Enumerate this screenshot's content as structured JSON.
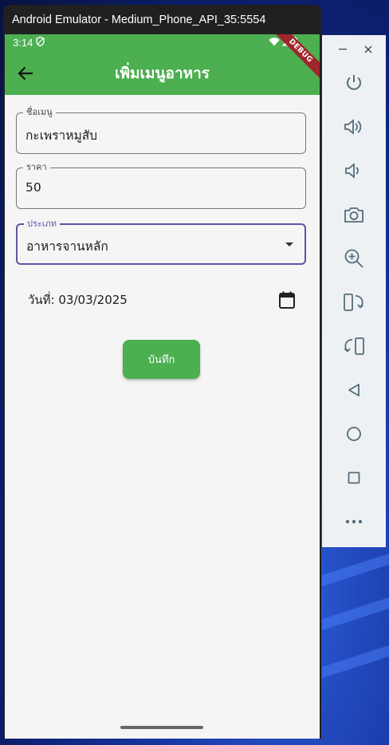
{
  "window": {
    "title": "Android Emulator - Medium_Phone_API_35:5554"
  },
  "status_bar": {
    "time": "3:14",
    "debug_banner": "DEBUG"
  },
  "app_bar": {
    "title": "เพิ่มเมนูอาหาร"
  },
  "form": {
    "name": {
      "label": "ชื่อเมนู",
      "value": "กะเพราหมูสับ"
    },
    "price": {
      "label": "ราคา",
      "value": "50"
    },
    "category": {
      "label": "ประเภท",
      "value": "อาหารจานหลัก"
    },
    "date_text": "วันที่: 03/03/2025",
    "save_label": "บันทึก"
  },
  "colors": {
    "primary": "#4caf50",
    "focus": "#6750a4",
    "debug": "#a0262d"
  },
  "toolbar_icons": [
    "power-icon",
    "volume-up-icon",
    "volume-down-icon",
    "camera-icon",
    "zoom-icon",
    "rotate-left-icon",
    "rotate-right-icon",
    "back-icon",
    "home-icon",
    "overview-icon",
    "more-icon"
  ]
}
